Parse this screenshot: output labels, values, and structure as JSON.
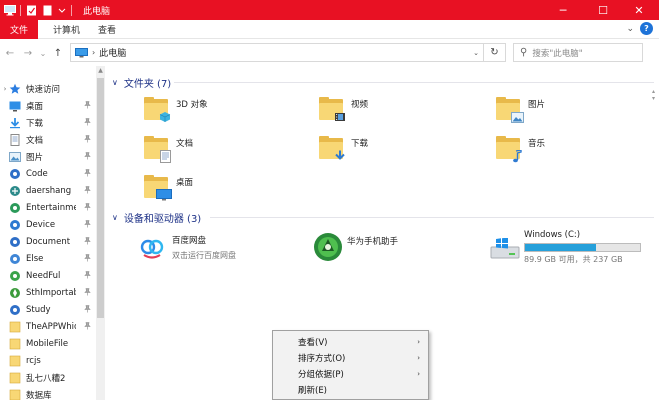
{
  "window": {
    "title": "此电脑",
    "accent": "#e81123",
    "controls": {
      "minimize": "─",
      "maximize": "☐",
      "close": "✕"
    }
  },
  "ribbon": {
    "tabs": [
      "文件",
      "计算机",
      "查看"
    ],
    "expand_glyph": "⌄",
    "help": "?"
  },
  "nav": {
    "back": "←",
    "forward": "→",
    "recent": "⌄",
    "up": "↑",
    "breadcrumb": "此电脑",
    "crumb_sep": "›",
    "dropdown": "⌄",
    "refresh": "↻"
  },
  "search": {
    "placeholder": "搜索\"此电脑\"",
    "icon": "⚲"
  },
  "sidebar": {
    "items": [
      {
        "label": "快速访问",
        "icon": "star-icon",
        "expand": "›",
        "pinned": false
      },
      {
        "label": "桌面",
        "icon": "desktop-folder-icon",
        "pinned": true
      },
      {
        "label": "下载",
        "icon": "download-folder-icon",
        "pinned": true
      },
      {
        "label": "文档",
        "icon": "documents-folder-icon",
        "pinned": true
      },
      {
        "label": "图片",
        "icon": "pictures-folder-icon",
        "pinned": true
      },
      {
        "label": "Code",
        "icon": "code-folder-icon",
        "pinned": true
      },
      {
        "label": "daershang",
        "icon": "app-folder-icon",
        "pinned": true
      },
      {
        "label": "Entertainme",
        "icon": "app-folder-icon",
        "pinned": true
      },
      {
        "label": "Device",
        "icon": "app-folder-icon",
        "pinned": true
      },
      {
        "label": "Document",
        "icon": "app-folder-icon",
        "pinned": true
      },
      {
        "label": "Else",
        "icon": "app-folder-icon",
        "pinned": true
      },
      {
        "label": "NeedFul",
        "icon": "app-folder-icon",
        "pinned": true
      },
      {
        "label": "SthImportab",
        "icon": "app-folder-icon",
        "pinned": true
      },
      {
        "label": "Study",
        "icon": "app-folder-icon",
        "pinned": true
      },
      {
        "label": "TheAPPWhic",
        "icon": "folder-icon",
        "pinned": true
      },
      {
        "label": "MobileFile",
        "icon": "folder-icon",
        "pinned": false
      },
      {
        "label": "rcjs",
        "icon": "folder-icon",
        "pinned": false
      },
      {
        "label": "乱七八糟2",
        "icon": "folder-icon",
        "pinned": false
      },
      {
        "label": "数据库",
        "icon": "folder-icon",
        "pinned": false
      }
    ],
    "pin_glyph": "📌"
  },
  "main": {
    "folders_header": "文件夹 (7)",
    "folders": [
      {
        "label": "3D 对象",
        "icon": "3d-objects-folder-icon"
      },
      {
        "label": "视频",
        "icon": "videos-folder-icon"
      },
      {
        "label": "图片",
        "icon": "pictures-folder-icon"
      },
      {
        "label": "文档",
        "icon": "documents-folder-icon"
      },
      {
        "label": "下载",
        "icon": "downloads-folder-icon"
      },
      {
        "label": "音乐",
        "icon": "music-folder-icon"
      },
      {
        "label": "桌面",
        "icon": "desktop-folder-icon"
      }
    ],
    "devices_header": "设备和驱动器 (3)",
    "devices": [
      {
        "name": "百度网盘",
        "sub": "双击运行百度网盘",
        "icon": "baidu-netdisk-icon"
      },
      {
        "name": "华为手机助手",
        "sub": "",
        "icon": "huawei-hisuite-icon"
      },
      {
        "name": "Windows (C:)",
        "sub": "89.9 GB 可用，共 237 GB",
        "icon": "windows-drive-icon",
        "used_fraction": 0.62
      }
    ],
    "chevron": "∨"
  },
  "context_menu": {
    "items": [
      {
        "label": "查看(V)",
        "submenu": true
      },
      {
        "label": "排序方式(O)",
        "submenu": true
      },
      {
        "label": "分组依据(P)",
        "submenu": true
      },
      {
        "label": "刷新(E)",
        "submenu": false
      }
    ],
    "submenu_glyph": "›"
  },
  "colors": {
    "folder": "#f8d775",
    "folder_back": "#e8b94a",
    "header_text": "#1e3287",
    "drive_fill": "#26a0da"
  }
}
